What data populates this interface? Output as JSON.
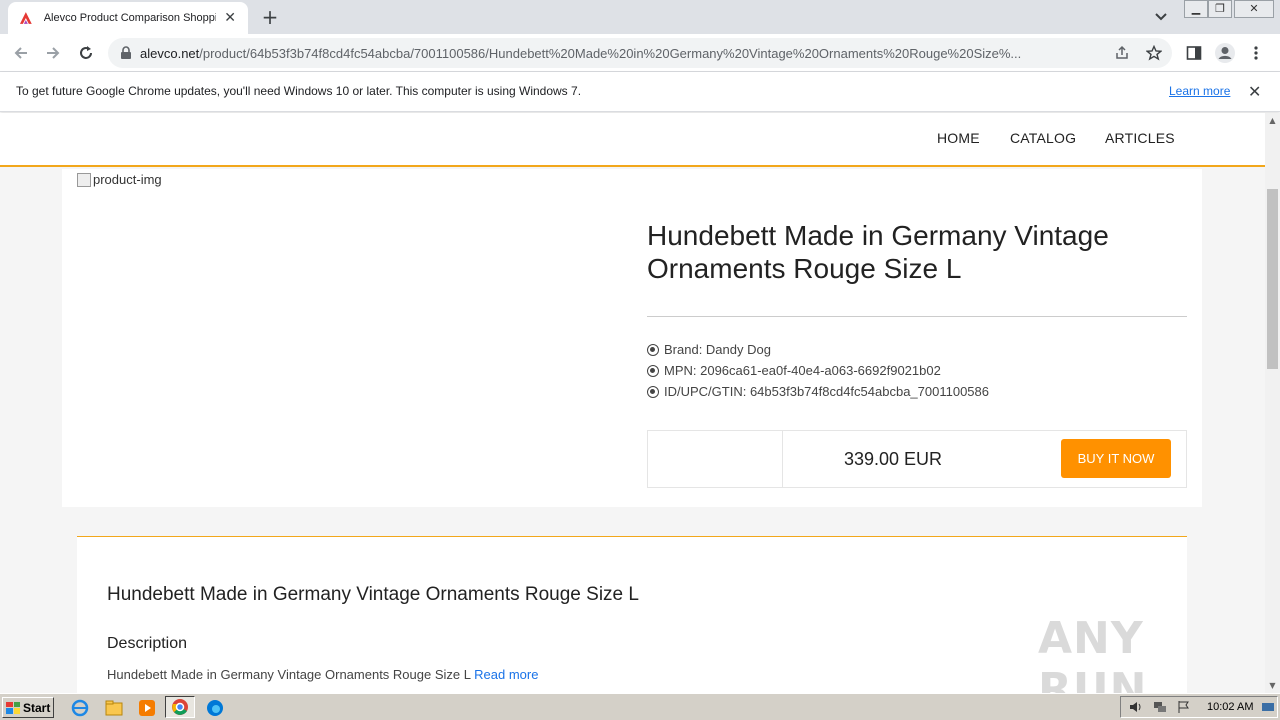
{
  "browser": {
    "tab_title": "Alevco Product Comparison Shopping",
    "url_domain": "alevco.net",
    "url_path": "/product/64b53f3b74f8cd4fc54abcba/7001100586/Hundebett%20Made%20in%20Germany%20Vintage%20Ornaments%20Rouge%20Size%..."
  },
  "infobar": {
    "message": "To get future Google Chrome updates, you'll need Windows 10 or later. This computer is using Windows 7.",
    "link": "Learn more"
  },
  "site_nav": {
    "items": [
      "HOME",
      "CATALOG",
      "ARTICLES"
    ]
  },
  "product": {
    "image_alt": "product-img",
    "title": "Hundebett Made in Germany Vintage Ornaments Rouge Size L",
    "specs": [
      "Brand: Dandy Dog",
      "MPN: 2096ca61-ea0f-40e4-a063-6692f9021b02",
      "ID/UPC/GTIN: 64b53f3b74f8cd4fc54abcba_7001100586"
    ],
    "price": "339.00 EUR",
    "buy_label": "BUY IT NOW"
  },
  "description": {
    "title": "Hundebett Made in Germany Vintage Ornaments Rouge Size L",
    "heading": "Description",
    "text": "Hundebett Made in Germany Vintage Ornaments Rouge Size L",
    "read_more": "Read more"
  },
  "watermark": "ANY RUN",
  "taskbar": {
    "start_label": "Start",
    "clock": "10:02 AM"
  },
  "colors": {
    "accent": "#f2a71b",
    "buy_button": "#ff9100",
    "link": "#1a73e8"
  }
}
